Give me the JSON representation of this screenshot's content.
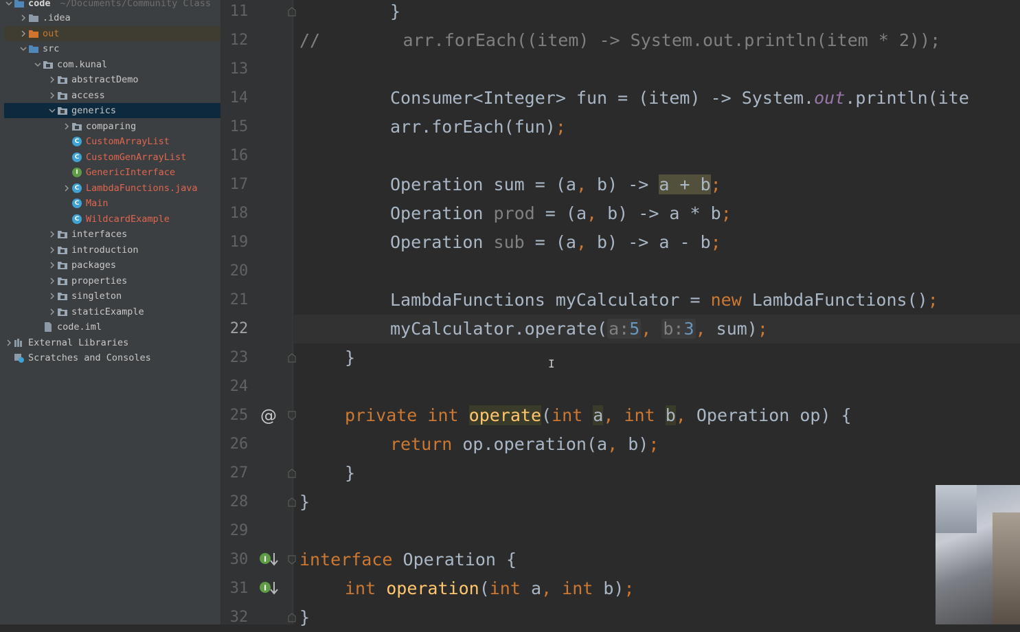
{
  "project": {
    "root_name": "code",
    "root_path": "~/Documents/Community Class",
    "items": [
      {
        "label": ".idea",
        "type": "folder",
        "arrow": "right"
      },
      {
        "label": "out",
        "type": "folder-orange",
        "arrow": "right"
      },
      {
        "label": "src",
        "type": "folder-src",
        "arrow": "down"
      },
      {
        "label": "com.kunal",
        "type": "package",
        "arrow": "down"
      },
      {
        "label": "abstractDemo",
        "type": "package",
        "arrow": "right"
      },
      {
        "label": "access",
        "type": "package",
        "arrow": "right"
      },
      {
        "label": "generics",
        "type": "package",
        "arrow": "down"
      },
      {
        "label": "comparing",
        "type": "package",
        "arrow": "right"
      },
      {
        "label": "CustomArrayList",
        "type": "class"
      },
      {
        "label": "CustomGenArrayList",
        "type": "class"
      },
      {
        "label": "GenericInterface",
        "type": "interface"
      },
      {
        "label": "LambdaFunctions.java",
        "type": "class",
        "arrow": "right"
      },
      {
        "label": "Main",
        "type": "class"
      },
      {
        "label": "WildcardExample",
        "type": "class"
      },
      {
        "label": "interfaces",
        "type": "package",
        "arrow": "right"
      },
      {
        "label": "introduction",
        "type": "package",
        "arrow": "right"
      },
      {
        "label": "packages",
        "type": "package",
        "arrow": "right"
      },
      {
        "label": "properties",
        "type": "package",
        "arrow": "right"
      },
      {
        "label": "singleton",
        "type": "package",
        "arrow": "right"
      },
      {
        "label": "staticExample",
        "type": "package",
        "arrow": "right"
      },
      {
        "label": "code.iml",
        "type": "file"
      },
      {
        "label": "External Libraries",
        "type": "libraries",
        "arrow": "right"
      },
      {
        "label": "Scratches and Consoles",
        "type": "scratches"
      }
    ]
  },
  "editor": {
    "line_numbers": [
      "11",
      "12",
      "13",
      "14",
      "15",
      "16",
      "17",
      "18",
      "19",
      "20",
      "21",
      "22",
      "23",
      "24",
      "25",
      "26",
      "27",
      "28",
      "29",
      "30",
      "31",
      "32"
    ],
    "current_line": "22",
    "code": {
      "l11_brace": "}",
      "l12_comment": "//        arr.forEach((item) -> System.out.println(item * 2));",
      "l14_a": "Consumer<Integer> fun = (item) -> System.",
      "l14_field": "out",
      "l14_b": ".println(ite",
      "l15_a": "arr.forEach(fun)",
      "l17_a": "Operation sum = (a",
      "l17_b": " b) -> ",
      "l17_c": "a + b",
      "l18_a": "Operation ",
      "l18_var": "prod",
      "l18_b": " = (a",
      "l18_c": " b) -> a * b",
      "l19_a": "Operation ",
      "l19_var": "sub",
      "l19_b": " = (a",
      "l19_c": " b) -> a - b",
      "l21_a": "LambdaFunctions myCalculator = ",
      "l21_new": "new",
      "l21_b": " LambdaFunctions()",
      "l22_a": "myCalculator.operate(",
      "l22_hint_a": "a:",
      "l22_val_a": "5",
      "l22_hint_b": "b:",
      "l22_val_b": "3",
      "l22_b": " sum)",
      "l23_brace": "}",
      "l25_private": "private",
      "l25_int": "int",
      "l25_method": "operate",
      "l25_paren": "(",
      "l25_int2": "int",
      "l25_pa": "a",
      "l25_int3": "int",
      "l25_pb": "b",
      "l25_rest": " Operation op) {",
      "l26_return": "return",
      "l26_rest": " op.operation(a",
      "l26_rest2": " b)",
      "l27_brace": "}",
      "l28_brace": "}",
      "l30_interface": "interface",
      "l30_rest": " Operation {",
      "l31_int": "int",
      "l31_method": "operation",
      "l31_paren": "(",
      "l31_int2": "int",
      "l31_a": " a",
      "l31_int3": "int",
      "l31_b": " b)",
      "l32_brace": "}"
    }
  },
  "colors": {
    "keyword": "#cc7832",
    "method": "#ffc66d",
    "number": "#6897bb",
    "field": "#9876aa",
    "text": "#a9b7c6",
    "comment": "#808080"
  }
}
